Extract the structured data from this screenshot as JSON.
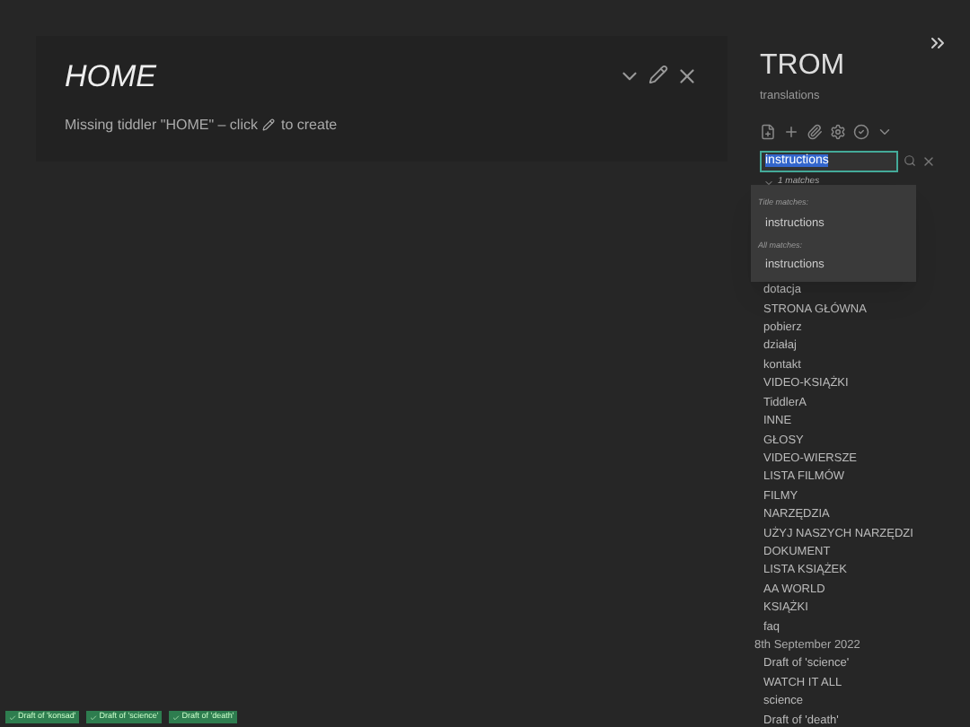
{
  "tiddler": {
    "title": "HOME",
    "message_before": "Missing tiddler \"HOME\" – click",
    "message_after": "to create"
  },
  "sidebar": {
    "title": "TROM",
    "subtitle": "translations",
    "search": {
      "value": "instructions",
      "matches": "1 matches"
    },
    "popup": {
      "sections": [
        {
          "heading": "Title matches:",
          "items": [
            "instructions"
          ]
        },
        {
          "heading": "All matches:",
          "items": [
            "instructions"
          ]
        }
      ]
    },
    "items": [
      {
        "kind": "item",
        "label": "dotacja"
      },
      {
        "kind": "item",
        "label": "STRONA GŁÓWNA"
      },
      {
        "kind": "item",
        "label": "pobierz"
      },
      {
        "kind": "item",
        "label": "działaj"
      },
      {
        "kind": "item",
        "label": "kontakt"
      },
      {
        "kind": "item",
        "label": "VIDEO-KSIĄŻKI"
      },
      {
        "kind": "item",
        "label": "TiddlerA"
      },
      {
        "kind": "item",
        "label": "INNE"
      },
      {
        "kind": "item",
        "label": "GŁOSY"
      },
      {
        "kind": "item",
        "label": "VIDEO-WIERSZE"
      },
      {
        "kind": "item",
        "label": "LISTA FILMÓW"
      },
      {
        "kind": "item",
        "label": "FILMY"
      },
      {
        "kind": "item",
        "label": "NARZĘDZIA"
      },
      {
        "kind": "item",
        "label": "UŻYJ NASZYCH NARZĘDZI"
      },
      {
        "kind": "item",
        "label": "DOKUMENT"
      },
      {
        "kind": "item",
        "label": "LISTA KSIĄŻEK"
      },
      {
        "kind": "item",
        "label": "AA WORLD"
      },
      {
        "kind": "item",
        "label": "KSIĄŻKI"
      },
      {
        "kind": "item",
        "label": "faq"
      },
      {
        "kind": "heading",
        "label": "8th September 2022"
      },
      {
        "kind": "item",
        "label": "Draft of 'science'"
      },
      {
        "kind": "item",
        "label": "WATCH IT ALL"
      },
      {
        "kind": "item",
        "label": "science"
      },
      {
        "kind": "item",
        "label": "Draft of 'death'"
      }
    ]
  },
  "drafts": [
    "Draft of 'konsad'",
    "Draft of 'science'",
    "Draft of 'death'"
  ]
}
